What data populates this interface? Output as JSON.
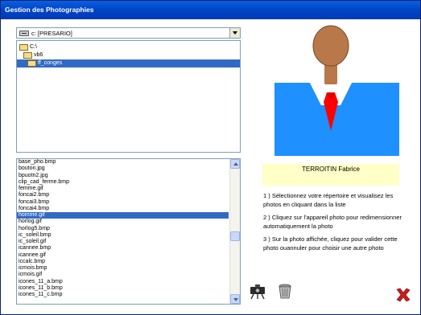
{
  "window": {
    "title": "Gestion des Photographies",
    "titlebar_color": "#0054e3"
  },
  "drive": {
    "selected": "c: [PRESARIO]",
    "icon": "hard-drive-icon"
  },
  "directories": [
    {
      "label": "C:\\",
      "icon": "open-folder-icon"
    },
    {
      "label": "vb6",
      "icon": "open-folder-icon"
    },
    {
      "label": "ff_conges",
      "icon": "open-folder-icon",
      "selected": true
    }
  ],
  "files": [
    {
      "name": "base_pho.bmp"
    },
    {
      "name": "bouton.jpg"
    },
    {
      "name": "bpuotn2.jpg"
    },
    {
      "name": "clip_cad_ferme.bmp"
    },
    {
      "name": "femme.gif"
    },
    {
      "name": "foncai2.bmp"
    },
    {
      "name": "foncai3.bmp"
    },
    {
      "name": "foncai4.bmp"
    },
    {
      "name": "homme.gif",
      "selected": true
    },
    {
      "name": "horlog.gif"
    },
    {
      "name": "horlog5.bmp"
    },
    {
      "name": "ic_soleil.bmp"
    },
    {
      "name": "ic_soleil.gif"
    },
    {
      "name": "icannee.bmp"
    },
    {
      "name": "icannee.gif"
    },
    {
      "name": "iccalc.bmp"
    },
    {
      "name": "icmois.bmp"
    },
    {
      "name": "icmois.gif"
    },
    {
      "name": "icones_11_a.bmp"
    },
    {
      "name": "icones_11_b.bmp"
    },
    {
      "name": "icones_11_c.bmp"
    }
  ],
  "photo": {
    "subject": "homme.gif",
    "colors": {
      "skin": "#b9784a",
      "shirt": "#1e90ff",
      "tie": "#ff0000",
      "collar": "#ffffff"
    }
  },
  "person": {
    "name": "TERROITIN Fabrice",
    "label_bg": "#ffffc8"
  },
  "instructions": [
    "1 ) Sélectionnez votre répertoire et visualisez les photos en cliquant dans la liste",
    "2 ) Cliquez sur l'appareil photo pour redimensionner automatiquement la photo",
    "3 ) Sur la photo affichée, cliquez pour valider cette photo ouannuler pour choisir une autre photo"
  ],
  "toolbar": {
    "camera_icon": "camera-icon",
    "trash_icon": "trash-icon",
    "close_icon": "close-icon",
    "close_color": "#c81e1e"
  }
}
